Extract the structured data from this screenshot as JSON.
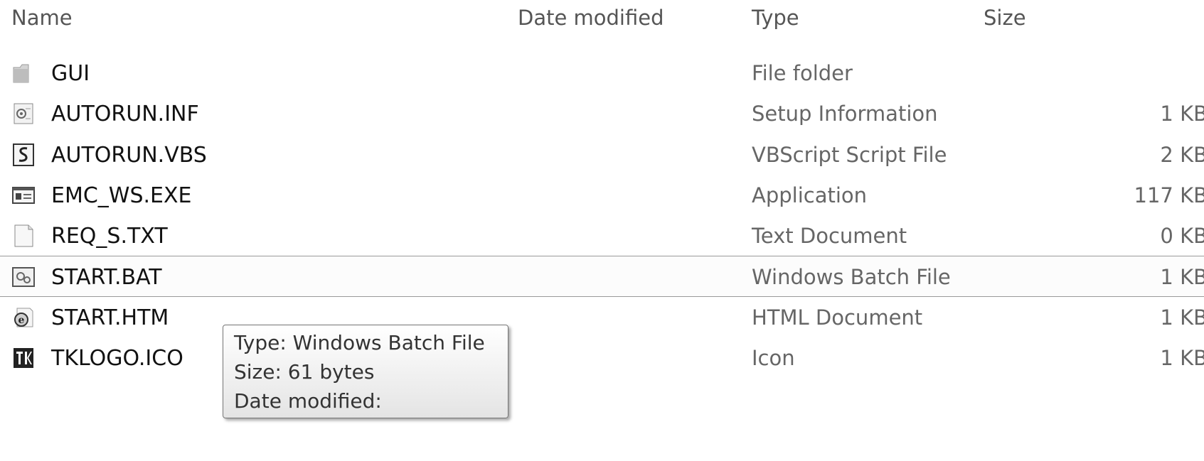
{
  "columns": {
    "name": "Name",
    "date_modified": "Date modified",
    "type": "Type",
    "size": "Size"
  },
  "files": [
    {
      "name": "GUI",
      "type": "File folder",
      "size": "",
      "icon": "folder-icon"
    },
    {
      "name": "AUTORUN.INF",
      "type": "Setup Information",
      "size": "1 KB",
      "icon": "setup-info-icon"
    },
    {
      "name": "AUTORUN.VBS",
      "type": "VBScript Script File",
      "size": "2 KB",
      "icon": "vbscript-icon"
    },
    {
      "name": "EMC_WS.EXE",
      "type": "Application",
      "size": "117 KB",
      "icon": "application-icon"
    },
    {
      "name": "REQ_S.TXT",
      "type": "Text Document",
      "size": "0 KB",
      "icon": "text-document-icon"
    },
    {
      "name": "START.BAT",
      "type": "Windows Batch File",
      "size": "1 KB",
      "icon": "batch-file-icon",
      "selected": true
    },
    {
      "name": "START.HTM",
      "type": "HTML Document",
      "size": "1 KB",
      "icon": "html-document-icon"
    },
    {
      "name": "TKLOGO.ICO",
      "type": "Icon",
      "size": "1 KB",
      "icon": "ico-file-icon"
    }
  ],
  "tooltip": {
    "type_line": "Type: Windows Batch File",
    "size_line": "Size: 61 bytes",
    "date_line": "Date modified:"
  }
}
